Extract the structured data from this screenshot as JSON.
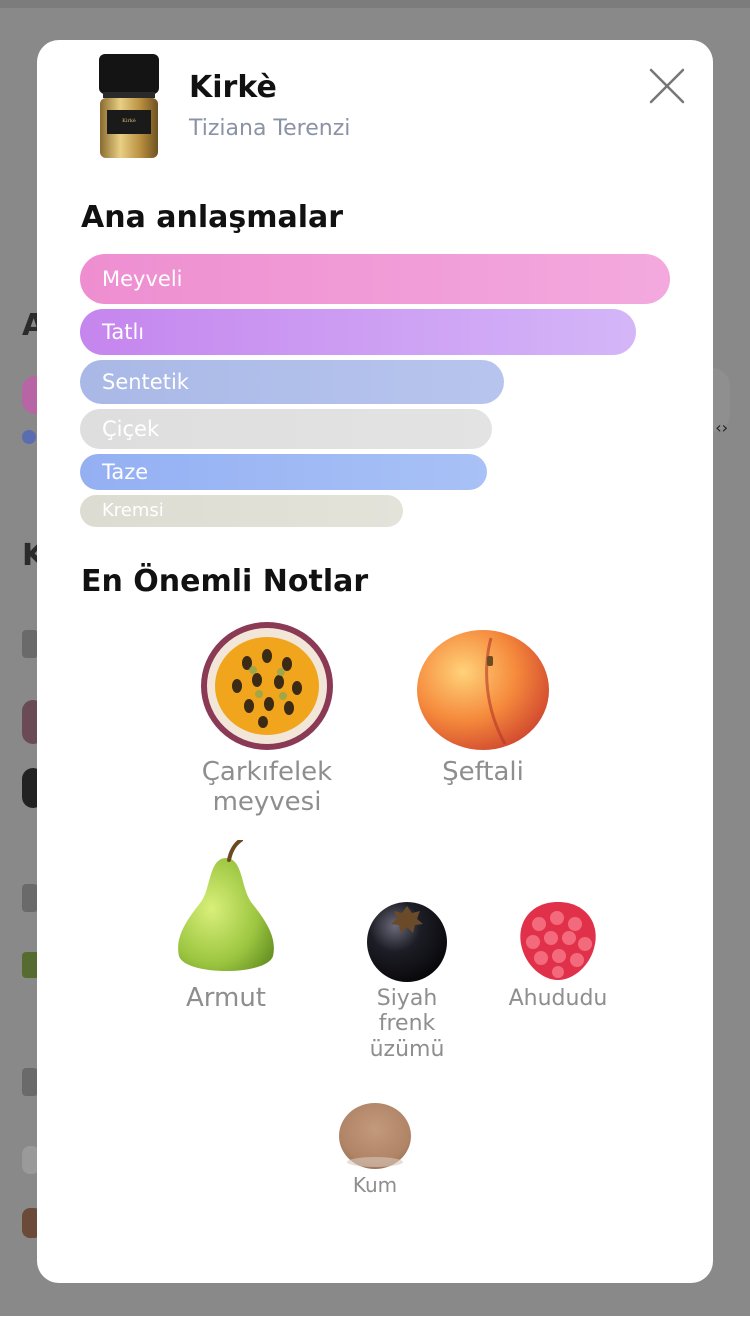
{
  "modal": {
    "title": "Kirkè",
    "brand": "Tiziana Terenzi",
    "bottle_label": "Kirkè",
    "close_icon": "close-icon"
  },
  "accords_section": {
    "heading": "Ana anlaşmalar",
    "items": [
      {
        "label": "Meyveli",
        "strength": 1.0,
        "color_from": "#ee8ed0",
        "color_to": "#f3a9de"
      },
      {
        "label": "Tatlı",
        "strength": 0.943,
        "color_from": "#c585ee",
        "color_to": "#d4b6f8"
      },
      {
        "label": "Sentetik",
        "strength": 0.718,
        "color_from": "#a9b8e6",
        "color_to": "#b7c5ee"
      },
      {
        "label": "Çiçek",
        "strength": 0.699,
        "color_from": "#dedede",
        "color_to": "#e3e3e3"
      },
      {
        "label": "Taze",
        "strength": 0.69,
        "color_from": "#94b0f3",
        "color_to": "#a8c1f6"
      },
      {
        "label": "Kremsi",
        "strength": 0.548,
        "color_from": "#dcdcd2",
        "color_to": "#e3e3da"
      }
    ]
  },
  "notes_section": {
    "heading": "En Önemli Notlar",
    "items": [
      {
        "name": "Çarkıfelek meyvesi",
        "icon": "passion-fruit-icon"
      },
      {
        "name": "Şeftali",
        "icon": "peach-icon"
      },
      {
        "name": "Armut",
        "icon": "pear-icon"
      },
      {
        "name": "Siyah frenk üzümü",
        "icon": "blackcurrant-icon"
      },
      {
        "name": "Ahududu",
        "icon": "raspberry-icon"
      },
      {
        "name": "Kum",
        "icon": "sand-icon"
      }
    ]
  },
  "colors": {
    "overlay": "#898989",
    "modal_bg": "#ffffff",
    "note_text": "#8e8e8e",
    "brand_text": "#8a93a6"
  }
}
